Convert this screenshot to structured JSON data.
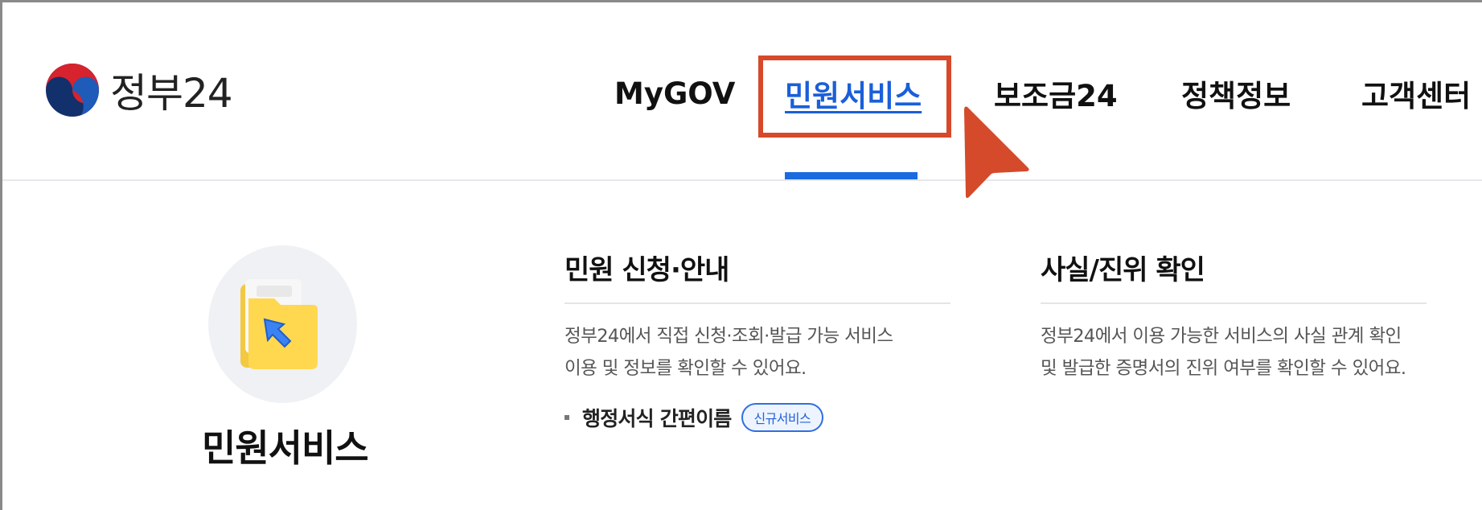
{
  "logo": {
    "text": "정부24",
    "icon": "taegeuk-emblem-icon"
  },
  "nav": {
    "items": [
      {
        "label": "MyGOV",
        "active": false
      },
      {
        "label": "민원서비스",
        "active": true
      },
      {
        "label": "보조금24",
        "active": false
      },
      {
        "label": "정책정보",
        "active": false
      },
      {
        "label": "고객센터",
        "active": false
      }
    ]
  },
  "colors": {
    "accent": "#1a6be0",
    "highlight": "#d6492a"
  },
  "mega_menu": {
    "category": {
      "title": "민원서비스",
      "icon": "folder-cursor-icon"
    },
    "sections": [
      {
        "title": "민원 신청·안내",
        "description_lines": [
          "정부24에서 직접 신청·조회·발급 가능 서비스",
          "이용 및 정보를 확인할 수 있어요."
        ],
        "links": [
          {
            "label": "행정서식 간편이름",
            "badge": "신규서비스"
          }
        ]
      },
      {
        "title": "사실/진위 확인",
        "description_lines": [
          "정부24에서 이용 가능한 서비스의 사실 관계 확인",
          "및 발급한 증명서의 진위 여부를 확인할 수 있어요."
        ]
      }
    ]
  }
}
